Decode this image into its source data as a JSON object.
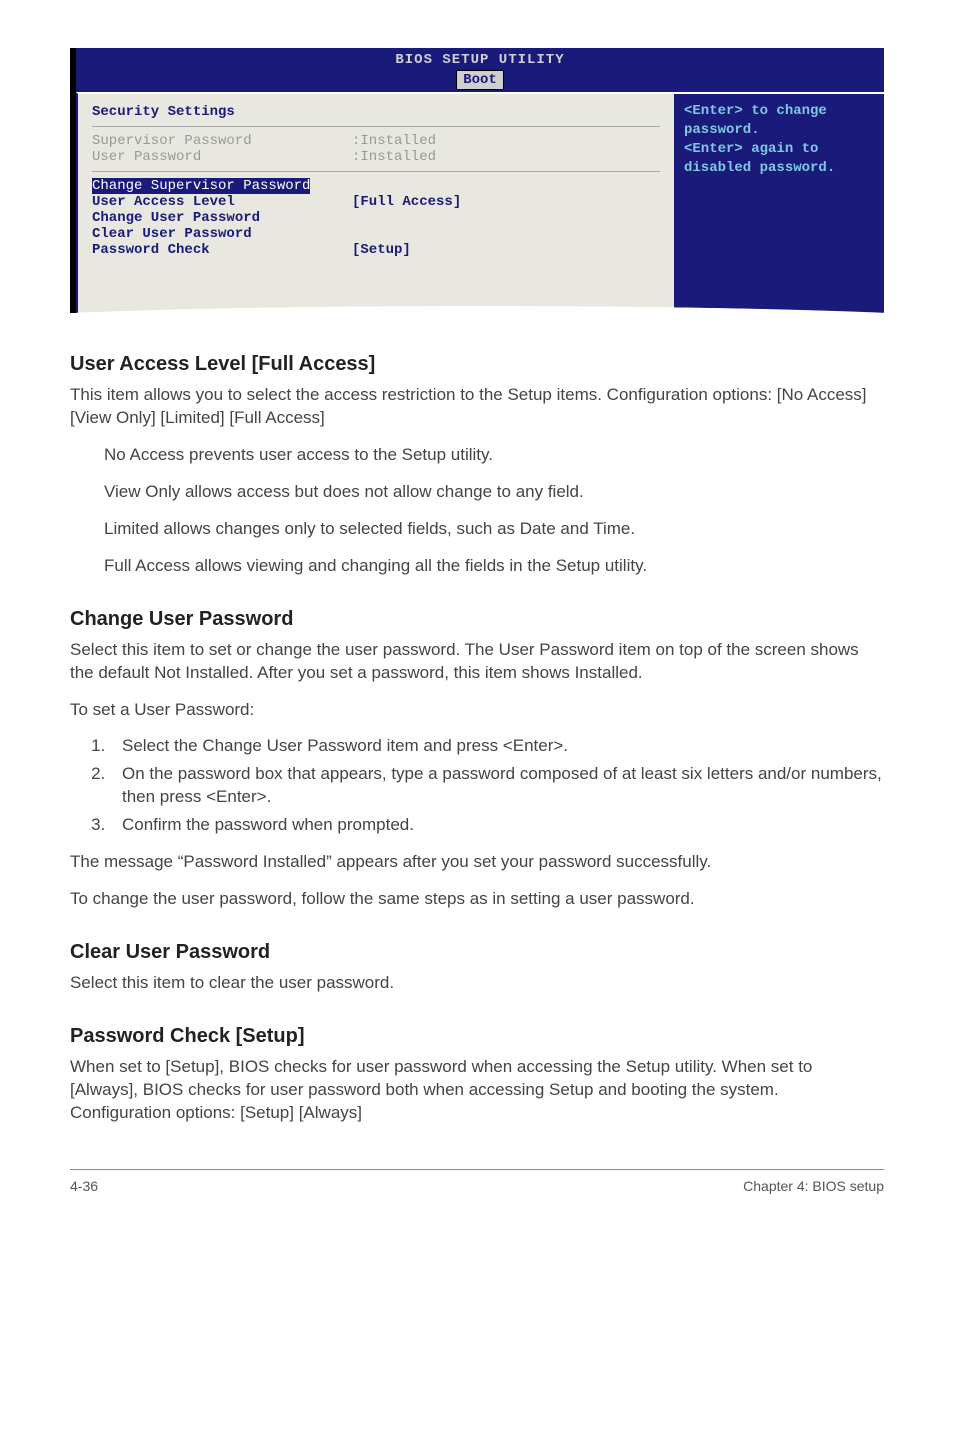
{
  "bios": {
    "title": "BIOS SETUP UTILITY",
    "tab": "Boot",
    "panel_title": "Security Settings",
    "rows": {
      "sup_pw_label": "Supervisor Password",
      "sup_pw_val": ":Installed",
      "user_pw_label": "User Password",
      "user_pw_val": ":Installed",
      "change_sup": "Change Supervisor Password",
      "ual_label": "User Access Level",
      "ual_val": "[Full Access]",
      "change_user": "Change User Password",
      "clear_user": "Clear User Password",
      "pwcheck_label": "Password Check",
      "pwcheck_val": "[Setup]"
    },
    "help1": "<Enter> to change password.",
    "help2": "<Enter> again to disabled password."
  },
  "sec1": {
    "heading": "User Access Level [Full Access]",
    "p1": "This item allows you to select the access restriction to the Setup items. Configuration options: [No Access] [View Only] [Limited] [Full Access]",
    "b1": "No Access prevents user access to the Setup utility.",
    "b2": "View Only allows access but does not allow change to any field.",
    "b3": "Limited allows changes only to selected fields, such as Date and Time.",
    "b4": "Full Access allows viewing and changing all the fields in the Setup utility."
  },
  "sec2": {
    "heading": "Change User Password",
    "p1": "Select this item to set or change the user password. The User Password item on top of the screen shows the default Not Installed. After you set a password, this item shows Installed.",
    "p2": "To set a User Password:",
    "s1": "Select the Change User Password item and press <Enter>.",
    "s2": "On the password box that appears, type a password composed of at least six letters and/or numbers, then press <Enter>.",
    "s3": "Confirm the password when prompted.",
    "p3": "The message “Password Installed” appears after you set your password successfully.",
    "p4": "To change the user password, follow the same steps as in setting a user password."
  },
  "sec3": {
    "heading": "Clear User Password",
    "p1": "Select this item to clear the user password."
  },
  "sec4": {
    "heading": "Password Check [Setup]",
    "p1": "When set to [Setup], BIOS checks for user password when accessing the Setup utility. When set to [Always], BIOS checks for user password both when accessing Setup and booting the system. Configuration options: [Setup] [Always]"
  },
  "footer": {
    "left": "4-36",
    "right": "Chapter 4: BIOS setup"
  }
}
